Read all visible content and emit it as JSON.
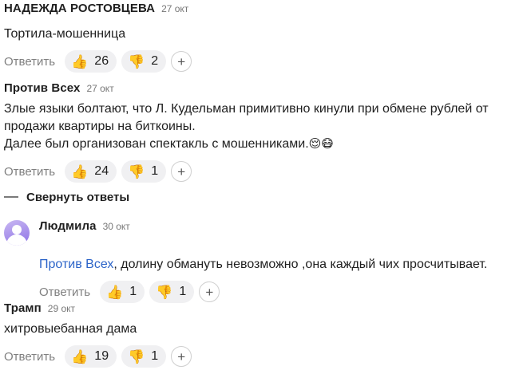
{
  "comments": [
    {
      "author": "НАДЕЖДА РОСТОВЦЕВА",
      "date": "27 окт",
      "text": "Тортила-мошенница",
      "reply_label": "Ответить",
      "likes": "26",
      "dislikes": "2"
    },
    {
      "author": "Против Всех",
      "date": "27 окт",
      "text": "Злые языки болтают, что Л. Кудельман примитивно кинули при обмене рублей от продажи квартиры на биткоины.\nДалее был организован спектакль с мошенниками.",
      "text_emojis": "😌😷",
      "reply_label": "Ответить",
      "likes": "24",
      "dislikes": "1"
    },
    {
      "author": "Людмила",
      "date": "30 окт",
      "mention": "Против Всех",
      "text": ", долину обмануть невозможно ,она каждый чих просчитывает.",
      "reply_label": "Ответить",
      "likes": "1",
      "dislikes": "1"
    },
    {
      "author": "Трамп",
      "date": "29 окт",
      "text": "хитровыебанная дама",
      "reply_label": "Ответить",
      "likes": "19",
      "dislikes": "1"
    }
  ],
  "collapse_label": "Свернуть ответы",
  "icons": {
    "like": "👍",
    "dislike": "👎",
    "add": "+"
  }
}
